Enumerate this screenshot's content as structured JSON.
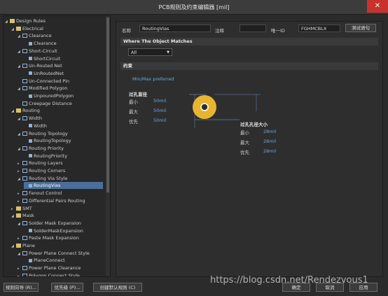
{
  "window": {
    "title": "PCB规则及约束编辑器 [mil]",
    "close_glyph": "✕"
  },
  "tree": [
    {
      "label": "Design Rules",
      "indent": 0,
      "arrow": "◢",
      "icon": "folder"
    },
    {
      "label": "Electrical",
      "indent": 1,
      "arrow": "◢",
      "icon": "folder"
    },
    {
      "label": "Clearance",
      "indent": 2,
      "arrow": "◢",
      "icon": "rule"
    },
    {
      "label": "Clearance",
      "indent": 3,
      "arrow": "",
      "icon": "leaf"
    },
    {
      "label": "Short-Circuit",
      "indent": 2,
      "arrow": "◢",
      "icon": "rule"
    },
    {
      "label": "ShortCircuit",
      "indent": 3,
      "arrow": "",
      "icon": "leaf"
    },
    {
      "label": "Un-Routed Net",
      "indent": 2,
      "arrow": "◢",
      "icon": "rule"
    },
    {
      "label": "UnRoutedNet",
      "indent": 3,
      "arrow": "",
      "icon": "leaf"
    },
    {
      "label": "Un-Connected Pin",
      "indent": 2,
      "arrow": "",
      "icon": "rule"
    },
    {
      "label": "Modified Polygon",
      "indent": 2,
      "arrow": "◢",
      "icon": "rule"
    },
    {
      "label": "UnpouredPolygon",
      "indent": 3,
      "arrow": "",
      "icon": "leaf"
    },
    {
      "label": "Creepage Distance",
      "indent": 2,
      "arrow": "",
      "icon": "rule"
    },
    {
      "label": "Routing",
      "indent": 1,
      "arrow": "◢",
      "icon": "folder"
    },
    {
      "label": "Width",
      "indent": 2,
      "arrow": "◢",
      "icon": "rule"
    },
    {
      "label": "Width",
      "indent": 3,
      "arrow": "",
      "icon": "leaf"
    },
    {
      "label": "Routing Topology",
      "indent": 2,
      "arrow": "◢",
      "icon": "rule"
    },
    {
      "label": "RoutingTopology",
      "indent": 3,
      "arrow": "",
      "icon": "leaf"
    },
    {
      "label": "Routing Priority",
      "indent": 2,
      "arrow": "◢",
      "icon": "rule"
    },
    {
      "label": "RoutingPriority",
      "indent": 3,
      "arrow": "",
      "icon": "leaf"
    },
    {
      "label": "Routing Layers",
      "indent": 2,
      "arrow": "▸",
      "icon": "rule"
    },
    {
      "label": "Routing Corners",
      "indent": 2,
      "arrow": "▸",
      "icon": "rule"
    },
    {
      "label": "Routing Via Style",
      "indent": 2,
      "arrow": "◢",
      "icon": "rule"
    },
    {
      "label": "RoutingVias",
      "indent": 3,
      "arrow": "",
      "icon": "leaf",
      "selected": true
    },
    {
      "label": "Fanout Control",
      "indent": 2,
      "arrow": "▸",
      "icon": "rule"
    },
    {
      "label": "Differential Pairs Routing",
      "indent": 2,
      "arrow": "▸",
      "icon": "rule"
    },
    {
      "label": "SMT",
      "indent": 1,
      "arrow": "▸",
      "icon": "folder"
    },
    {
      "label": "Mask",
      "indent": 1,
      "arrow": "◢",
      "icon": "folder"
    },
    {
      "label": "Solder Mask Expansion",
      "indent": 2,
      "arrow": "◢",
      "icon": "rule"
    },
    {
      "label": "SolderMaskExpansion",
      "indent": 3,
      "arrow": "",
      "icon": "leaf"
    },
    {
      "label": "Paste Mask Expansion",
      "indent": 2,
      "arrow": "▸",
      "icon": "rule"
    },
    {
      "label": "Plane",
      "indent": 1,
      "arrow": "◢",
      "icon": "folder"
    },
    {
      "label": "Power Plane Connect Style",
      "indent": 2,
      "arrow": "◢",
      "icon": "rule"
    },
    {
      "label": "PlaneConnect",
      "indent": 3,
      "arrow": "",
      "icon": "leaf"
    },
    {
      "label": "Power Plane Clearance",
      "indent": 2,
      "arrow": "▸",
      "icon": "rule"
    },
    {
      "label": "Polygon Connect Style",
      "indent": 2,
      "arrow": "▸",
      "icon": "rule"
    }
  ],
  "form": {
    "name_label": "名称",
    "name_value": "RoutingVias",
    "comment_label": "注释",
    "comment_value": "",
    "uid_label": "唯一ID",
    "uid_value": "FGHMCBLX",
    "test_button": "测试语句",
    "match_section": "Where The Object Matches",
    "match_value": "All",
    "constraint_section": "约束",
    "preferred_text": "Min/Max preferred",
    "via_diameter_title": "过孔直径",
    "via_diameter_rows": [
      {
        "label": "最小",
        "value": "50mil"
      },
      {
        "label": "最大",
        "value": "50mil"
      },
      {
        "label": "优先",
        "value": "50mil"
      }
    ],
    "hole_size_title": "过孔孔径大小",
    "hole_size_rows": [
      {
        "label": "最小",
        "value": "28mil"
      },
      {
        "label": "最大",
        "value": "28mil"
      },
      {
        "label": "优先",
        "value": "28mil"
      }
    ]
  },
  "bottom": {
    "wizard": "规则向导 (R)...",
    "priority": "优先级 (P)...",
    "default_rules": "创建默认规则 (C)",
    "ok": "确定",
    "cancel": "取消",
    "apply": "应用"
  },
  "watermark": "https://blog.csdn.net/Rendezvous1",
  "colors": {
    "selection": "#4a6f99",
    "accent": "#6fa8dc",
    "via_ring": "#e8b530"
  }
}
